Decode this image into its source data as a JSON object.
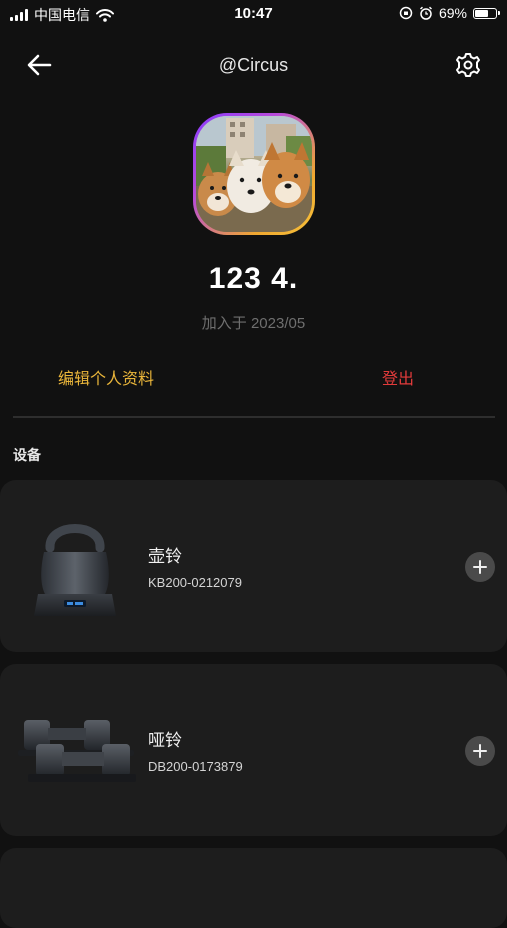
{
  "status_bar": {
    "carrier": "中国电信",
    "time": "10:47",
    "battery_percent": "69%",
    "battery_level": 0.69
  },
  "header": {
    "title": "@Circus",
    "back_icon": "arrow-left-icon",
    "settings_icon": "gear-icon"
  },
  "profile": {
    "name": "123 4.",
    "joined": "加入于 2023/05"
  },
  "actions": {
    "edit_profile": "编辑个人资料",
    "logout": "登出"
  },
  "devices_section": {
    "label": "设备",
    "items": [
      {
        "name": "壶铃",
        "serial": "KB200-0212079",
        "icon": "kettlebell-icon"
      },
      {
        "name": "哑铃",
        "serial": "DB200-0173879",
        "icon": "dumbbell-icon"
      }
    ]
  },
  "colors": {
    "background": "#111111",
    "card": "#1d1d1d",
    "edit_accent": "#e9b53a",
    "logout_accent": "#e23b3b"
  }
}
